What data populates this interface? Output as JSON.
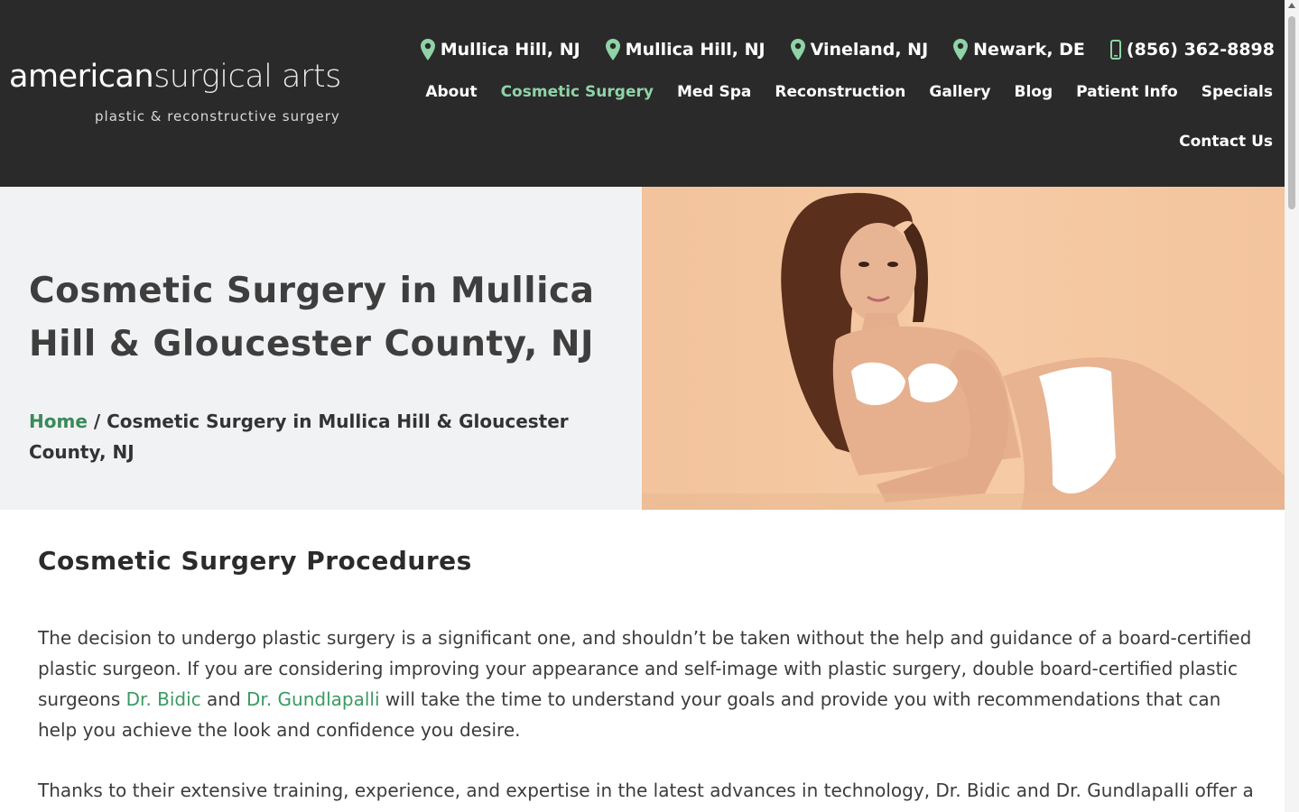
{
  "logo": {
    "word1": "american",
    "word2": "surgical arts",
    "tagline": "plastic & reconstructive surgery"
  },
  "locations": [
    {
      "label": "Mullica Hill, NJ",
      "icon": "map-pin-icon"
    },
    {
      "label": "Mullica Hill, NJ",
      "icon": "map-pin-icon"
    },
    {
      "label": "Vineland, NJ",
      "icon": "map-pin-icon"
    },
    {
      "label": "Newark, DE",
      "icon": "map-pin-icon"
    },
    {
      "label": "(856) 362-8898",
      "icon": "phone-icon"
    }
  ],
  "nav": {
    "items": [
      {
        "label": "About"
      },
      {
        "label": "Cosmetic Surgery",
        "active": true
      },
      {
        "label": "Med Spa"
      },
      {
        "label": "Reconstruction"
      },
      {
        "label": "Gallery"
      },
      {
        "label": "Blog"
      },
      {
        "label": "Patient Info"
      },
      {
        "label": "Specials"
      }
    ],
    "contact": "Contact Us"
  },
  "hero": {
    "title": "Cosmetic Surgery in Mullica Hill & Gloucester County, NJ",
    "breadcrumb_home": "Home",
    "breadcrumb_sep": " / ",
    "breadcrumb_current": "Cosmetic Surgery in Mullica Hill & Gloucester County, NJ"
  },
  "content": {
    "section_title": "Cosmetic Surgery Procedures",
    "para1_a": "The decision to undergo plastic surgery is a significant one, and shouldn’t be taken without the help and guidance of a board-certified plastic surgeon. If you are considering improving your appearance and self-image with plastic surgery, double board-certified plastic surgeons ",
    "link1": "Dr. Bidic",
    "para1_b": " and ",
    "link2": "Dr. Gundlapalli",
    "para1_c": " will take the time to understand your goals and provide you with recommendations that can help you achieve the look and confidence you desire.",
    "para2": "Thanks to their extensive training, experience, and expertise in the latest advances in technology, Dr. Bidic and Dr. Gundlapalli offer a"
  },
  "colors": {
    "header_bg": "#2a2a2a",
    "accent_green": "#8fd3a7",
    "link_green": "#3a9a62",
    "pin_green": "#8fd3a7"
  }
}
